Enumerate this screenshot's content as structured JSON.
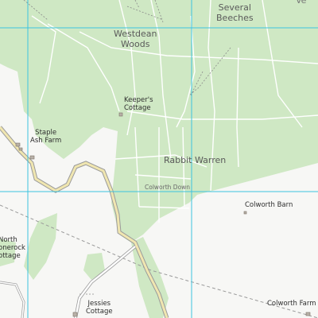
{
  "labels": {
    "several_beeches": [
      "Several",
      "Beeches"
    ],
    "westdean_woods": [
      "Westdean",
      "Woods"
    ],
    "keepers_cottage": [
      "Keeper's",
      "Cottage"
    ],
    "staple_ash_farm": [
      "Staple",
      "Ash Farm"
    ],
    "rabbit_warren": "Rabbit Warren",
    "colworth_down": "Colworth Down",
    "colworth_barn": "Colworth Barn",
    "north_stonerock_cottage": [
      "North",
      "onerock",
      "ottage"
    ],
    "jessies_cottage": [
      "Jessies",
      "Cottage"
    ],
    "colworth_farm": "Colworth Farm",
    "top_right_fragment": "Ve"
  },
  "colors": {
    "woodland": "#cfe8c4",
    "background": "#f7f7f5",
    "grid": "#3cc3e0",
    "road_casing": "#a0a0a0",
    "minor_road": "#f0e6b0",
    "track": "#ffffff",
    "path_dashed": "#8a8a8a",
    "railway": "#9a9a9a"
  },
  "icons": [
    "building-icon",
    "gate-icon"
  ]
}
